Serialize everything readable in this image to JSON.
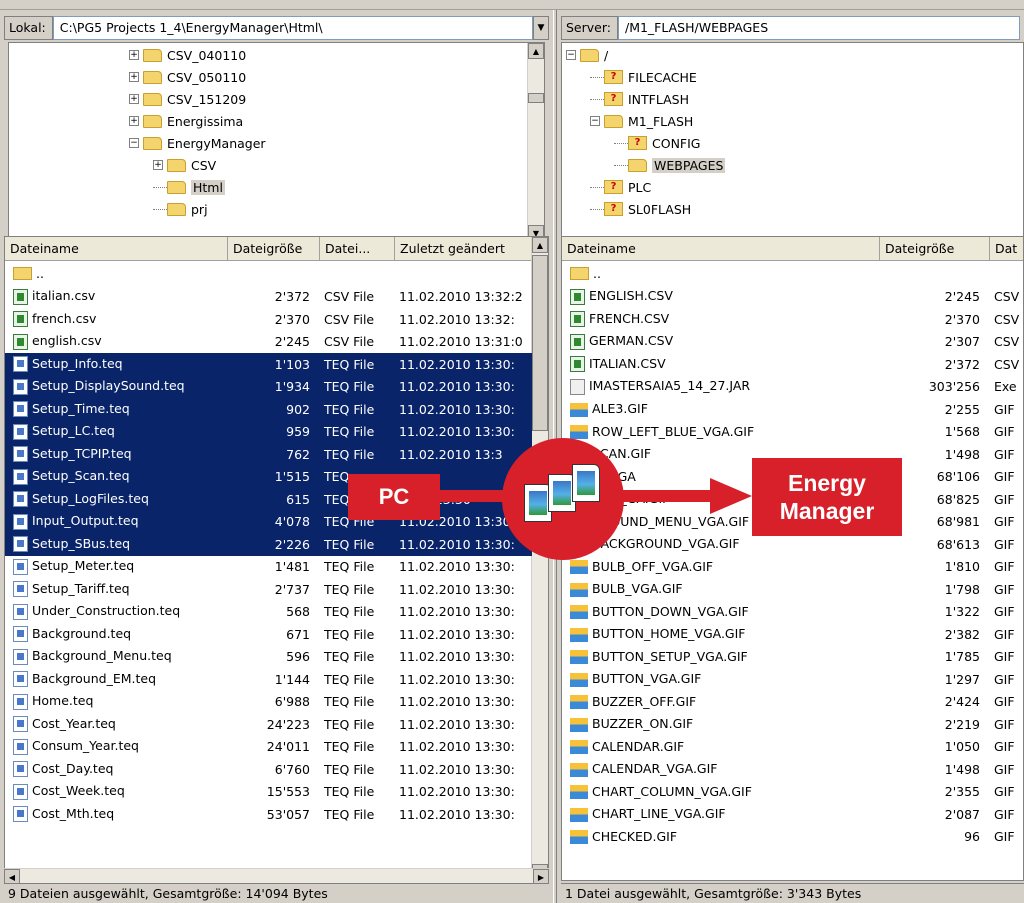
{
  "left": {
    "path_label": "Lokal:",
    "path_value": "C:\\PG5 Projects 1_4\\EnergyManager\\Html\\",
    "tree": [
      {
        "label": "CSV_040110",
        "toggle": "+",
        "indent": 0
      },
      {
        "label": "CSV_050110",
        "toggle": "+",
        "indent": 0
      },
      {
        "label": "CSV_151209",
        "toggle": "+",
        "indent": 0
      },
      {
        "label": "Energissima",
        "toggle": "+",
        "indent": 0
      },
      {
        "label": "EnergyManager",
        "toggle": "−",
        "indent": 0
      },
      {
        "label": "CSV",
        "toggle": "+",
        "indent": 1
      },
      {
        "label": "Html",
        "toggle": "",
        "indent": 1,
        "selected": true
      },
      {
        "label": "prj",
        "toggle": "",
        "indent": 1
      }
    ],
    "columns": [
      "Dateiname",
      "Dateigröße",
      "Datei...",
      "Zuletzt geändert"
    ],
    "parent_label": "..",
    "files": [
      {
        "name": "italian.csv",
        "size": "2'372",
        "type": "CSV File",
        "date": "11.02.2010 13:32:2",
        "icon": "csv",
        "sel": false
      },
      {
        "name": "french.csv",
        "size": "2'370",
        "type": "CSV File",
        "date": "11.02.2010 13:32:",
        "icon": "csv",
        "sel": false
      },
      {
        "name": "english.csv",
        "size": "2'245",
        "type": "CSV File",
        "date": "11.02.2010 13:31:0",
        "icon": "csv",
        "sel": false
      },
      {
        "name": "Setup_Info.teq",
        "size": "1'103",
        "type": "TEQ File",
        "date": "11.02.2010 13:30:",
        "icon": "teq",
        "sel": true
      },
      {
        "name": "Setup_DisplaySound.teq",
        "size": "1'934",
        "type": "TEQ File",
        "date": "11.02.2010 13:30:",
        "icon": "teq",
        "sel": true
      },
      {
        "name": "Setup_Time.teq",
        "size": "902",
        "type": "TEQ File",
        "date": "11.02.2010 13:30:",
        "icon": "teq",
        "sel": true
      },
      {
        "name": "Setup_LC.teq",
        "size": "959",
        "type": "TEQ File",
        "date": "11.02.2010 13:30:",
        "icon": "teq",
        "sel": true
      },
      {
        "name": "Setup_TCPIP.teq",
        "size": "762",
        "type": "TEQ File",
        "date": "11.02.2010 13:3",
        "icon": "teq",
        "sel": true
      },
      {
        "name": "Setup_Scan.teq",
        "size": "1'515",
        "type": "TEQ",
        "date": "",
        "icon": "teq",
        "sel": true
      },
      {
        "name": "Setup_LogFiles.teq",
        "size": "615",
        "type": "TEQ",
        "date": "2010 13:30",
        "icon": "teq",
        "sel": true
      },
      {
        "name": "Input_Output.teq",
        "size": "4'078",
        "type": "TEQ File",
        "date": "11.02.2010 13:30",
        "icon": "teq",
        "sel": true
      },
      {
        "name": "Setup_SBus.teq",
        "size": "2'226",
        "type": "TEQ File",
        "date": "11.02.2010 13:30:",
        "icon": "teq",
        "sel": true
      },
      {
        "name": "Setup_Meter.teq",
        "size": "1'481",
        "type": "TEQ File",
        "date": "11.02.2010 13:30:",
        "icon": "teq",
        "sel": false
      },
      {
        "name": "Setup_Tariff.teq",
        "size": "2'737",
        "type": "TEQ File",
        "date": "11.02.2010 13:30:",
        "icon": "teq",
        "sel": false
      },
      {
        "name": "Under_Construction.teq",
        "size": "568",
        "type": "TEQ File",
        "date": "11.02.2010 13:30:",
        "icon": "teq",
        "sel": false
      },
      {
        "name": "Background.teq",
        "size": "671",
        "type": "TEQ File",
        "date": "11.02.2010 13:30:",
        "icon": "teq",
        "sel": false
      },
      {
        "name": "Background_Menu.teq",
        "size": "596",
        "type": "TEQ File",
        "date": "11.02.2010 13:30:",
        "icon": "teq",
        "sel": false
      },
      {
        "name": "Background_EM.teq",
        "size": "1'144",
        "type": "TEQ File",
        "date": "11.02.2010 13:30:",
        "icon": "teq",
        "sel": false
      },
      {
        "name": "Home.teq",
        "size": "6'988",
        "type": "TEQ File",
        "date": "11.02.2010 13:30:",
        "icon": "teq",
        "sel": false
      },
      {
        "name": "Cost_Year.teq",
        "size": "24'223",
        "type": "TEQ File",
        "date": "11.02.2010 13:30:",
        "icon": "teq",
        "sel": false
      },
      {
        "name": "Consum_Year.teq",
        "size": "24'011",
        "type": "TEQ File",
        "date": "11.02.2010 13:30:",
        "icon": "teq",
        "sel": false
      },
      {
        "name": "Cost_Day.teq",
        "size": "6'760",
        "type": "TEQ File",
        "date": "11.02.2010 13:30:",
        "icon": "teq",
        "sel": false
      },
      {
        "name": "Cost_Week.teq",
        "size": "15'553",
        "type": "TEQ File",
        "date": "11.02.2010 13:30:",
        "icon": "teq",
        "sel": false
      },
      {
        "name": "Cost_Mth.teq",
        "size": "53'057",
        "type": "TEQ File",
        "date": "11.02.2010 13:30:",
        "icon": "teq",
        "sel": false
      }
    ],
    "status": "9 Dateien ausgewählt, Gesamtgröße: 14'094 Bytes"
  },
  "right": {
    "path_label": "Server:",
    "path_value": "/M1_FLASH/WEBPAGES",
    "tree": [
      {
        "label": "/",
        "toggle": "−",
        "indent": 0,
        "q": false
      },
      {
        "label": "FILECACHE",
        "toggle": "",
        "indent": 1,
        "q": true
      },
      {
        "label": "INTFLASH",
        "toggle": "",
        "indent": 1,
        "q": true
      },
      {
        "label": "M1_FLASH",
        "toggle": "−",
        "indent": 1,
        "q": false
      },
      {
        "label": "CONFIG",
        "toggle": "",
        "indent": 2,
        "q": true
      },
      {
        "label": "WEBPAGES",
        "toggle": "",
        "indent": 2,
        "q": false,
        "selected": true
      },
      {
        "label": "PLC",
        "toggle": "",
        "indent": 1,
        "q": true
      },
      {
        "label": "SL0FLASH",
        "toggle": "",
        "indent": 1,
        "q": true
      }
    ],
    "columns": [
      "Dateiname",
      "Dateigröße",
      "Dat"
    ],
    "parent_label": "..",
    "files": [
      {
        "name": "ENGLISH.CSV",
        "size": "2'245",
        "type": "CSV",
        "icon": "csv"
      },
      {
        "name": "FRENCH.CSV",
        "size": "2'370",
        "type": "CSV",
        "icon": "csv"
      },
      {
        "name": "GERMAN.CSV",
        "size": "2'307",
        "type": "CSV",
        "icon": "csv"
      },
      {
        "name": "ITALIAN.CSV",
        "size": "2'372",
        "type": "CSV",
        "icon": "csv"
      },
      {
        "name": "IMASTERSAIA5_14_27.JAR",
        "size": "303'256",
        "type": "Exe",
        "icon": "jar"
      },
      {
        "name": "ALE3.GIF",
        "size": "2'255",
        "type": "GIF",
        "icon": "gif"
      },
      {
        "name": "ROW_LEFT_BLUE_VGA.GIF",
        "size": "1'568",
        "type": "GIF",
        "icon": "gif"
      },
      {
        "name": "SCAN.GIF",
        "size": "1'498",
        "type": "GIF",
        "icon": "gif"
      },
      {
        "name": "M_VGA",
        "size": "68'106",
        "type": "GIF",
        "icon": "gif"
      },
      {
        "name": "OEM_GA.GIF",
        "size": "68'825",
        "type": "GIF",
        "icon": "gif"
      },
      {
        "name": "GROUND_MENU_VGA.GIF",
        "size": "68'981",
        "type": "GIF",
        "icon": "gif"
      },
      {
        "name": "BACKGROUND_VGA.GIF",
        "size": "68'613",
        "type": "GIF",
        "icon": "gif"
      },
      {
        "name": "BULB_OFF_VGA.GIF",
        "size": "1'810",
        "type": "GIF",
        "icon": "gif"
      },
      {
        "name": "BULB_VGA.GIF",
        "size": "1'798",
        "type": "GIF",
        "icon": "gif"
      },
      {
        "name": "BUTTON_DOWN_VGA.GIF",
        "size": "1'322",
        "type": "GIF",
        "icon": "gif"
      },
      {
        "name": "BUTTON_HOME_VGA.GIF",
        "size": "2'382",
        "type": "GIF",
        "icon": "gif"
      },
      {
        "name": "BUTTON_SETUP_VGA.GIF",
        "size": "1'785",
        "type": "GIF",
        "icon": "gif"
      },
      {
        "name": "BUTTON_VGA.GIF",
        "size": "1'297",
        "type": "GIF",
        "icon": "gif"
      },
      {
        "name": "BUZZER_OFF.GIF",
        "size": "2'424",
        "type": "GIF",
        "icon": "gif"
      },
      {
        "name": "BUZZER_ON.GIF",
        "size": "2'219",
        "type": "GIF",
        "icon": "gif"
      },
      {
        "name": "CALENDAR.GIF",
        "size": "1'050",
        "type": "GIF",
        "icon": "gif"
      },
      {
        "name": "CALENDAR_VGA.GIF",
        "size": "1'498",
        "type": "GIF",
        "icon": "gif"
      },
      {
        "name": "CHART_COLUMN_VGA.GIF",
        "size": "2'355",
        "type": "GIF",
        "icon": "gif"
      },
      {
        "name": "CHART_LINE_VGA.GIF",
        "size": "2'087",
        "type": "GIF",
        "icon": "gif"
      },
      {
        "name": "CHECKED.GIF",
        "size": "96",
        "type": "GIF",
        "icon": "gif"
      }
    ],
    "status": "1 Datei ausgewählt, Gesamtgröße: 3'343 Bytes"
  },
  "overlay": {
    "pc_label": "PC",
    "em_line1": "Energy",
    "em_line2": "Manager",
    "accent": "#d8202a"
  },
  "colors": {
    "selection": "#0a246a"
  }
}
